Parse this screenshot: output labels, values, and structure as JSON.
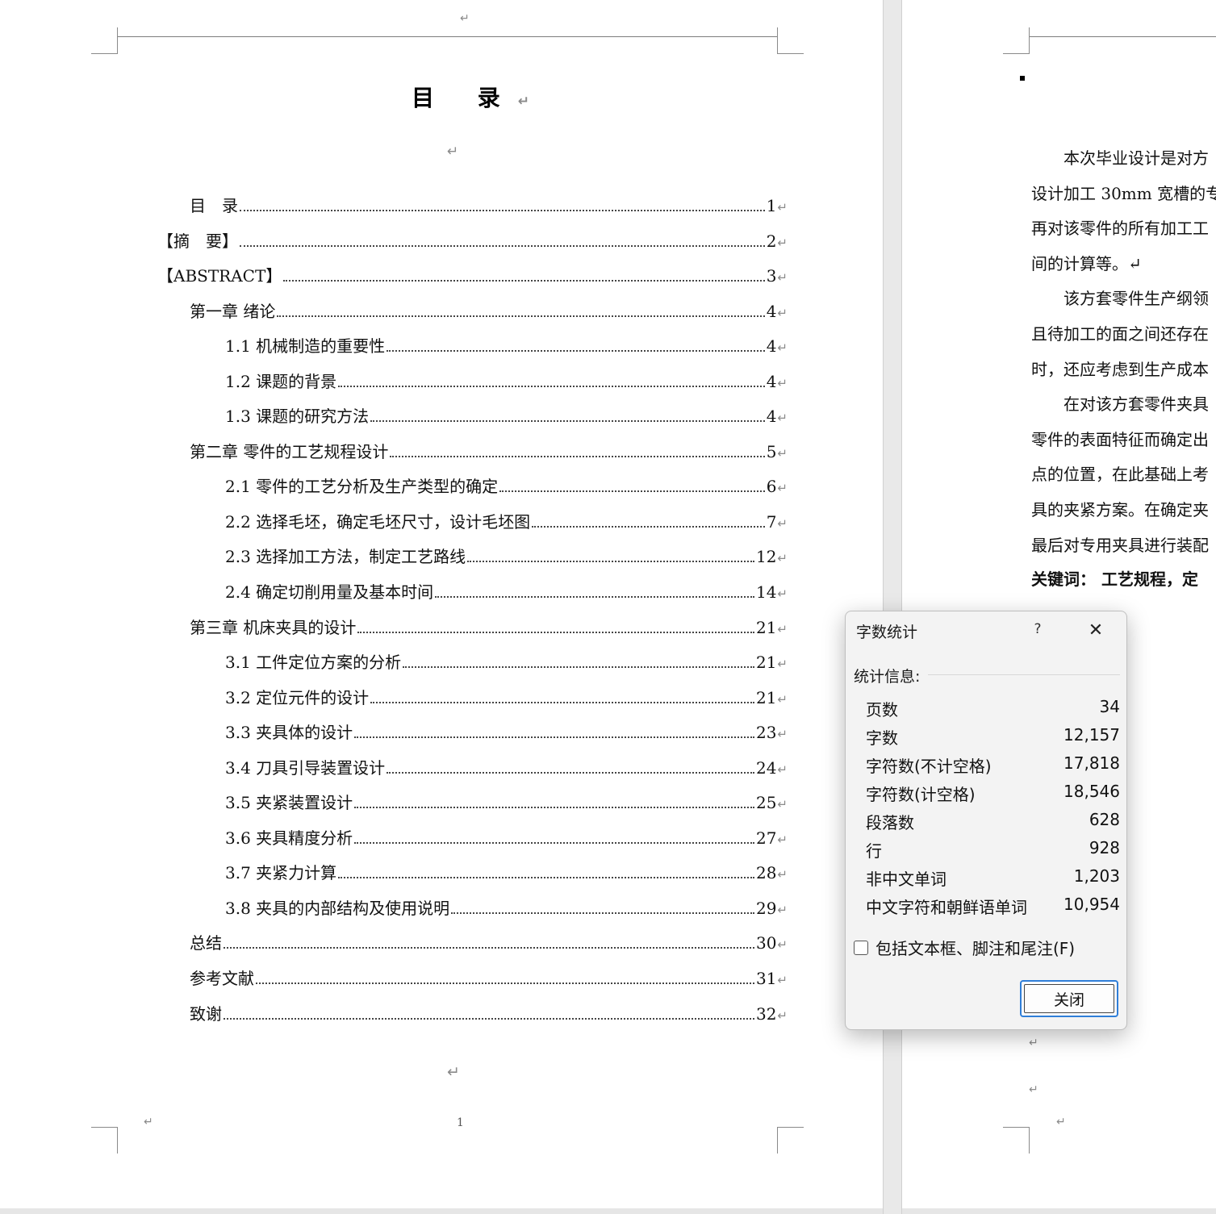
{
  "left_page": {
    "title": "目 录",
    "page_number": "1",
    "return_mark": "↵",
    "toc": [
      {
        "label": "目　录",
        "page": "1"
      },
      {
        "label": "【摘　要】",
        "page": "2"
      },
      {
        "label": "【ABSTRACT】",
        "page": "3"
      },
      {
        "label": "第一章  绪论",
        "page": "4"
      },
      {
        "label": "1.1 机械制造的重要性",
        "page": "4"
      },
      {
        "label": "1.2 课题的背景",
        "page": "4"
      },
      {
        "label": "1.3 课题的研究方法",
        "page": "4"
      },
      {
        "label": "第二章  零件的工艺规程设计",
        "page": "5"
      },
      {
        "label": "2.1 零件的工艺分析及生产类型的确定",
        "page": "6"
      },
      {
        "label": "2.2 选择毛坯，确定毛坯尺寸，设计毛坯图",
        "page": "7"
      },
      {
        "label": "2.3 选择加工方法，制定工艺路线",
        "page": "12"
      },
      {
        "label": "2.4 确定切削用量及基本时间",
        "page": "14"
      },
      {
        "label": "第三章  机床夹具的设计",
        "page": "21"
      },
      {
        "label": "3.1 工件定位方案的分析",
        "page": "21"
      },
      {
        "label": "3.2 定位元件的设计",
        "page": "21"
      },
      {
        "label": "3.3 夹具体的设计",
        "page": "23"
      },
      {
        "label": "3.4 刀具引导装置设计",
        "page": "24"
      },
      {
        "label": "3.5 夹紧装置设计",
        "page": "25"
      },
      {
        "label": "3.6 夹具精度分析",
        "page": "27"
      },
      {
        "label": "3.7 夹紧力计算",
        "page": "28"
      },
      {
        "label": "3.8 夹具的内部结构及使用说明",
        "page": "29"
      },
      {
        "label": "总结",
        "page": "30"
      },
      {
        "label": "参考文献",
        "page": "31"
      },
      {
        "label": "致谢",
        "page": "32"
      }
    ]
  },
  "right_page": {
    "lines": [
      "　　本次毕业设计是对方",
      "设计加工 30mm 宽槽的专",
      "再对该零件的所有加工工",
      "间的计算等。↵",
      "　　该方套零件生产纲领",
      "且待加工的面之间还存在",
      "时，还应考虑到生产成本",
      "　　在对该方套零件夹具",
      "零件的表面特征而确定出",
      "点的位置，在此基础上考",
      "具的夹紧方案。在确定夹",
      "最后对专用夹具进行装配"
    ],
    "keywords_line": "关键词：  工艺规程，定"
  },
  "dialog": {
    "title": "字数统计",
    "help": "?",
    "close_icon": "✕",
    "section_label": "统计信息:",
    "stats": [
      {
        "label": "页数",
        "value": "34"
      },
      {
        "label": "字数",
        "value": "12,157"
      },
      {
        "label": "字符数(不计空格)",
        "value": "17,818"
      },
      {
        "label": "字符数(计空格)",
        "value": "18,546"
      },
      {
        "label": "段落数",
        "value": "628"
      },
      {
        "label": "行",
        "value": "928"
      },
      {
        "label": "非中文单词",
        "value": "1,203"
      },
      {
        "label": "中文字符和朝鲜语单词",
        "value": "10,954"
      }
    ],
    "checkbox_label": "包括文本框、脚注和尾注(F)",
    "checkbox_checked": false,
    "close_button": "关闭"
  }
}
